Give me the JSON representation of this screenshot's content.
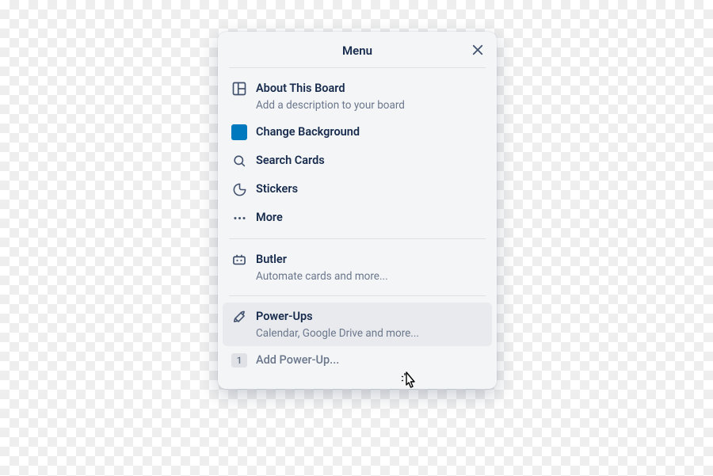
{
  "header": {
    "title": "Menu"
  },
  "sections": [
    {
      "items": [
        {
          "icon": "board",
          "label": "About This Board",
          "sub": "Add a description to your board"
        },
        {
          "icon": "swatch",
          "label": "Change Background"
        },
        {
          "icon": "search",
          "label": "Search Cards"
        },
        {
          "icon": "sticker",
          "label": "Stickers"
        },
        {
          "icon": "more",
          "label": "More"
        }
      ]
    },
    {
      "items": [
        {
          "icon": "butler",
          "label": "Butler",
          "sub": "Automate cards and more..."
        }
      ]
    },
    {
      "items": [
        {
          "icon": "rocket",
          "label": "Power-Ups",
          "sub": "Calendar, Google Drive and more...",
          "hovered": true
        },
        {
          "icon": "badge",
          "badge": "1",
          "label": "Add Power-Up...",
          "muted": true
        }
      ]
    }
  ]
}
